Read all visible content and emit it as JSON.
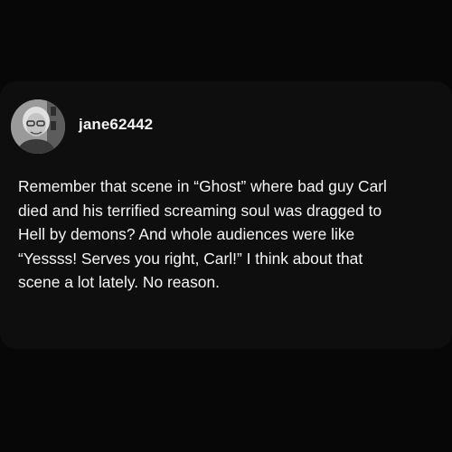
{
  "post": {
    "author": {
      "username": "jane62442",
      "avatar_icon": "user-avatar-photo"
    },
    "body": "Remember that scene in “Ghost” where bad guy Carl\ndied and his terrified screaming soul was dragged to\nHell by demons?  And whole audiences were like\n“Yessss!  Serves you right, Carl!” I think about that\nscene a lot lately.  No reason."
  },
  "colors": {
    "background": "#070707",
    "card": "#0e0e0e",
    "text": "#f5f5f5"
  }
}
